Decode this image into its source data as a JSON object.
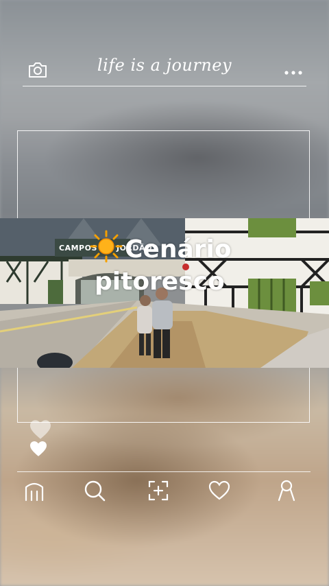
{
  "header": {
    "title": "life is a journey",
    "camera_icon": "camera-icon",
    "more_icon": "more-dots-icon"
  },
  "post": {
    "sign_text": "CAMPOS DO JORDÃO",
    "caption_line1": "Cenário",
    "caption_line2": "pitoresco",
    "emoji": "sun-emoji"
  },
  "reactions": {
    "like_icon": "heart-icon"
  },
  "bottom_nav": {
    "items": [
      {
        "icon": "home-icon"
      },
      {
        "icon": "search-icon"
      },
      {
        "icon": "add-post-icon"
      },
      {
        "icon": "heart-outline-icon"
      },
      {
        "icon": "profile-icon"
      }
    ]
  },
  "colors": {
    "ui_white": "#ffffff",
    "sun_orange": "#f5a000",
    "building_dark": "#2f3a30"
  }
}
